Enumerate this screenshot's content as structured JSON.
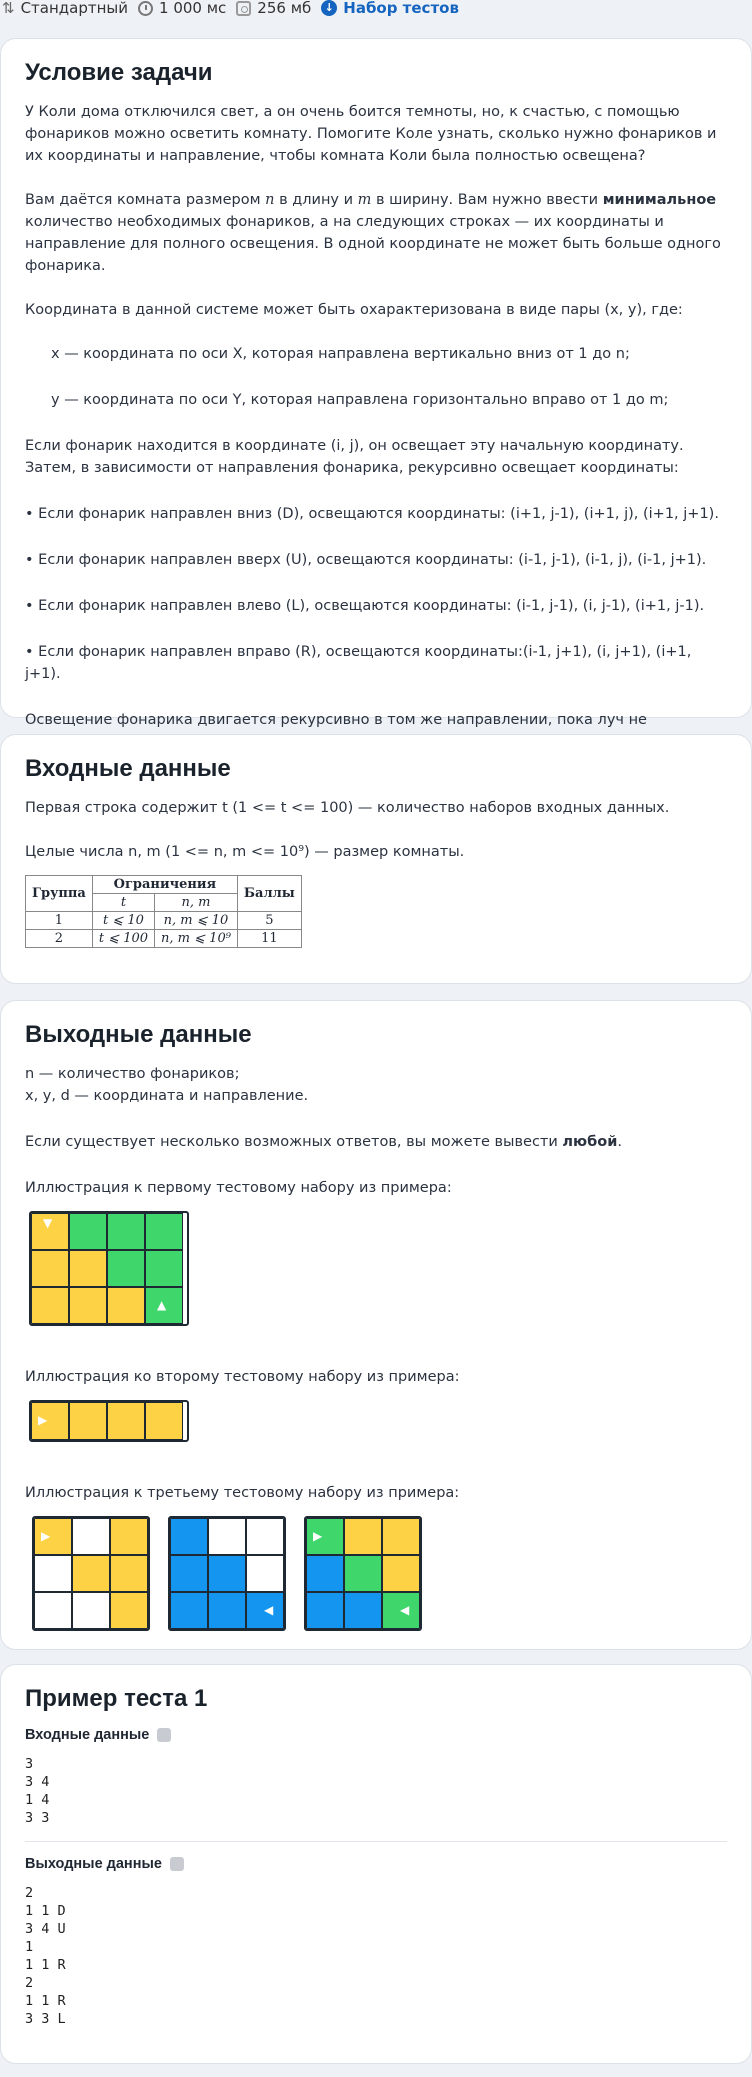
{
  "topbar": {
    "mode": "Стандартный",
    "time": "1 000 мс",
    "memory": "256 мб",
    "tests_link": "Набор тестов"
  },
  "statement": {
    "title": "Условие задачи",
    "p1": "У Коли дома отключился свет, а он очень боится темноты, но, к счастью, с помощью фонариков можно осветить комнату. Помогите Коле узнать, сколько нужно фонариков и их координаты и направление, чтобы комната Коли была полностью освещена?",
    "p2_a": "Вам даётся комната размером ",
    "p2_n": "n",
    "p2_b": " в длину и ",
    "p2_m": "m",
    "p2_c": " в ширину. Вам нужно ввести ",
    "p2_bold": "минимальное",
    "p2_d": " количество необходимых фонариков, а на следующих строках — их координаты и направление для полного освещения. В одной координате не может быть больше одного фонарика.",
    "p3": "Координата в данной системе может быть охарактеризована в виде пары (x, y),  где:",
    "x_line": "x — координата по оси X, которая направлена вертикально вниз  от 1 до n;",
    "y_line": "y — координата по оси Y, которая направлена горизонтально вправо от 1 до m;",
    "p4": "Если фонарик находится в координате (i, j), он освещает эту начальную координату. Затем, в зависимости от направления фонарика, рекурсивно освещает координаты:",
    "b1": "• Если фонарик направлен вниз (D), освещаются координаты: (i+1, j-1), (i+1, j), (i+1, j+1).",
    "b2": "• Если фонарик направлен вверх (U), освещаются координаты: (i-1, j-1), (i-1, j), (i-1, j+1).",
    "b3": "• Если фонарик направлен влево (L), освещаются координаты: (i-1, j-1), (i, j-1), (i+1, j-1).",
    "b4": "• Если фонарик направлен вправо (R), освещаются координаты:(i-1, j+1), (i, j+1), (i+1, j+1).",
    "p5": "Освещение фонарика двигается рекурсивно в том же направлении, пока луч не достигает стены."
  },
  "input": {
    "title": "Входные данные",
    "p1": "Первая строка содержит t (1 <= t <= 100) — количество наборов входных данных.",
    "p2": "Целые числа n, m (1 <= n, m <= 10⁹) — размер комнаты.",
    "table": {
      "h_group": "Группа",
      "h_limits": "Ограничения",
      "h_points": "Баллы",
      "h_t": "t",
      "h_nm": "n, m",
      "rows": [
        {
          "group": "1",
          "t": "t ⩽ 10",
          "nm": "n, m ⩽ 10",
          "points": "5"
        },
        {
          "group": "2",
          "t": "t ⩽ 100",
          "nm": "n, m ⩽ 10⁹",
          "points": "11"
        }
      ]
    }
  },
  "output": {
    "title": "Выходные данные",
    "l1": "n — количество фонариков;",
    "l2": "x, y, d — координата и направление.",
    "p_a": "Если существует несколько возможных ответов, вы можете вывести ",
    "p_bold": "любой",
    "p_end": ".",
    "ill1": "Иллюстрация к первому тестовому набору из примера:",
    "ill2": "Иллюстрация ко второму тестовому набору из примера:",
    "ill3": "Иллюстрация к третьему тестовому набору из примера:",
    "colors": {
      "yellow": "#fdd245",
      "green": "#3fd66c",
      "blue": "#1496f0"
    }
  },
  "example": {
    "title": "Пример теста 1",
    "input_label": "Входные данные",
    "input_text": "3\n3 4\n1 4\n3 3",
    "output_label": "Выходные данные",
    "output_text": "2\n1 1 D\n3 4 U\n1\n1 1 R\n2\n1 1 R\n3 3 L"
  }
}
